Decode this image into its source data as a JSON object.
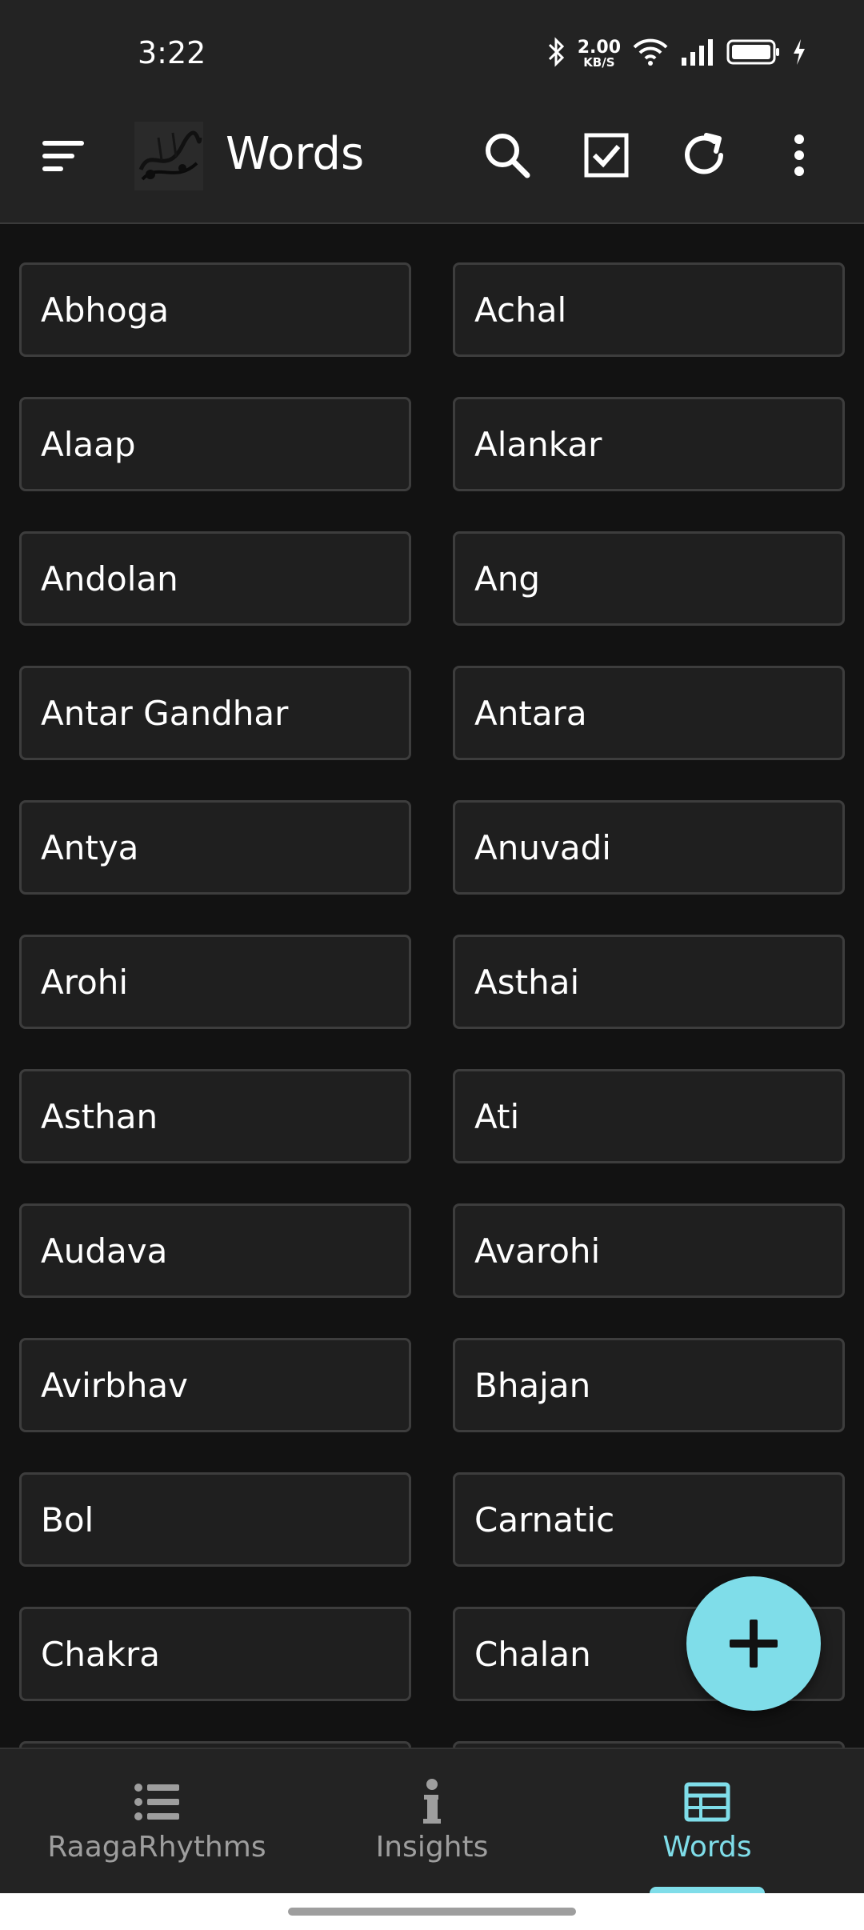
{
  "status": {
    "time": "3:22",
    "net_speed_value": "2.00",
    "net_speed_unit": "KB/S"
  },
  "app_bar": {
    "title": "Words",
    "icons": [
      "menu-icon",
      "app-logo",
      "search-icon",
      "checkbox-icon",
      "refresh-icon",
      "more-vert-icon"
    ]
  },
  "words": [
    "Abhoga",
    "Achal",
    "Alaap",
    "Alankar",
    "Andolan",
    "Ang",
    "Antar Gandhar",
    "Antara",
    "Antya",
    "Anuvadi",
    "Arohi",
    "Asthai",
    "Asthan",
    "Ati",
    "Audava",
    "Avarohi",
    "Avirbhav",
    "Bhajan",
    "Bol",
    "Carnatic",
    "Chakra",
    "Chalan",
    "",
    ""
  ],
  "fab": {
    "icon": "plus-icon"
  },
  "bottom_nav": {
    "items": [
      {
        "label": "RaagaRhythms",
        "icon": "list-icon"
      },
      {
        "label": "Insights",
        "icon": "info-icon"
      },
      {
        "label": "Words",
        "icon": "table-icon"
      }
    ],
    "active_color": "#7fdde9",
    "inactive_color": "#9e9e9e"
  }
}
